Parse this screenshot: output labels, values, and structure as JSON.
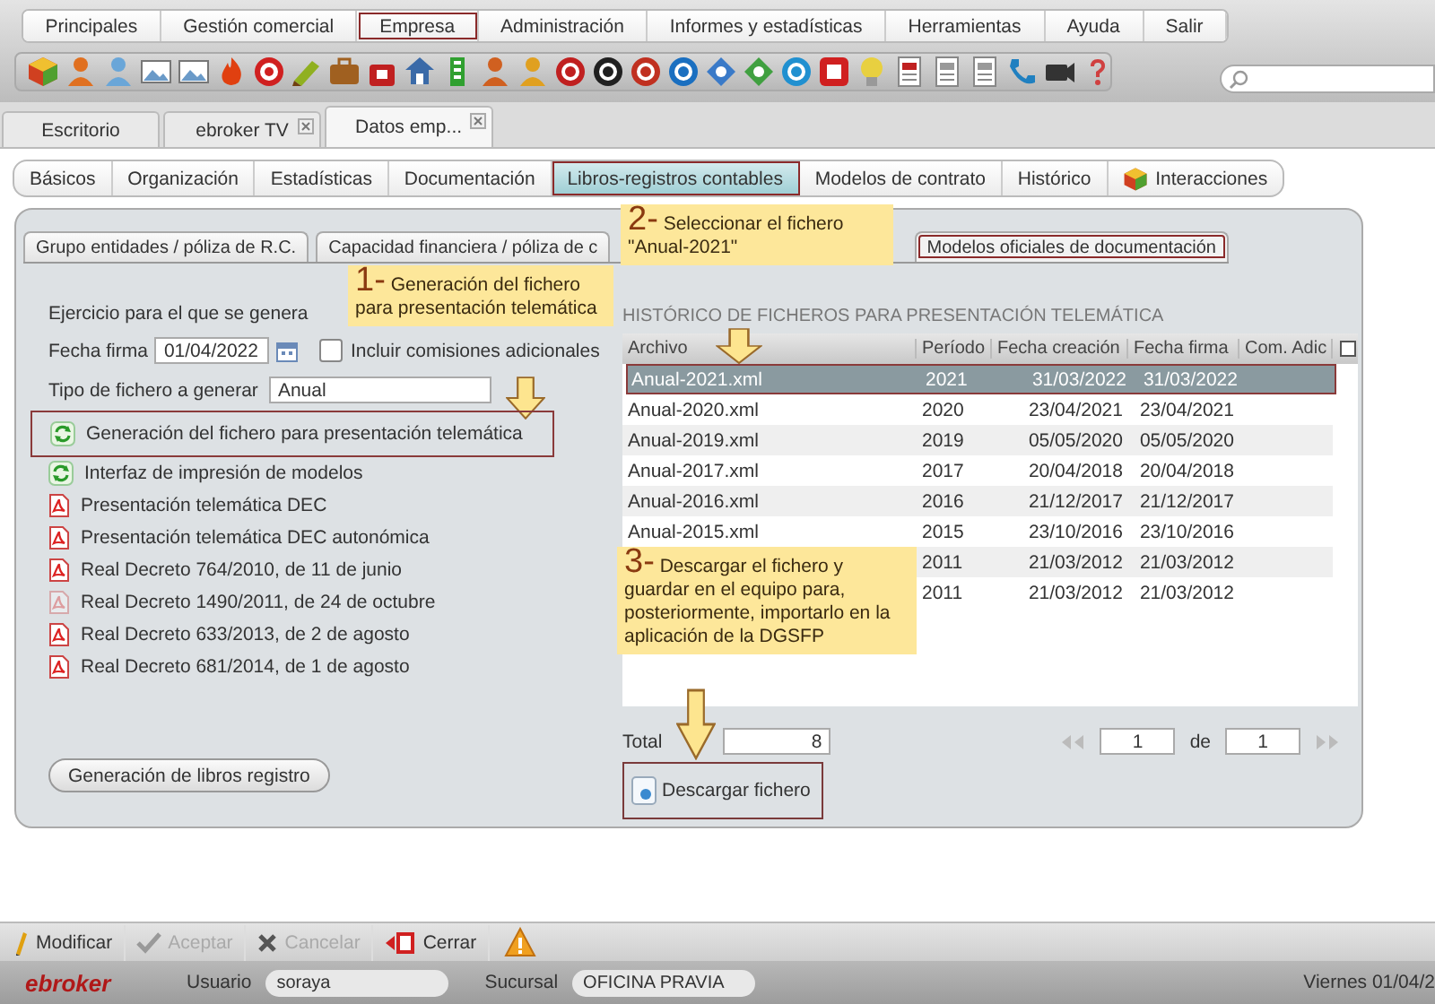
{
  "menu": [
    {
      "label": "Principales",
      "selected": false
    },
    {
      "label": "Gestión comercial",
      "selected": false
    },
    {
      "label": "Empresa",
      "selected": true
    },
    {
      "label": "Administración",
      "selected": false
    },
    {
      "label": "Informes y estadísticas",
      "selected": false
    },
    {
      "label": "Herramientas",
      "selected": false
    },
    {
      "label": "Ayuda",
      "selected": false
    },
    {
      "label": "Salir",
      "selected": false
    }
  ],
  "window_tabs": [
    {
      "label": "Escritorio",
      "selected": false,
      "closable": false
    },
    {
      "label": "ebroker TV",
      "selected": false,
      "closable": true
    },
    {
      "label": "Datos emp...",
      "selected": true,
      "closable": true
    }
  ],
  "section_tabs": [
    {
      "label": "Básicos",
      "selected": false,
      "kind": "text"
    },
    {
      "label": "Organización",
      "selected": false,
      "kind": "text"
    },
    {
      "label": "Estadísticas",
      "selected": false,
      "kind": "text"
    },
    {
      "label": "Documentación",
      "selected": false,
      "kind": "text"
    },
    {
      "label": "Libros-registros contables",
      "selected": true,
      "kind": "text"
    },
    {
      "label": "Modelos de contrato",
      "selected": false,
      "kind": "text"
    },
    {
      "label": "Histórico",
      "selected": false,
      "kind": "text"
    },
    {
      "label": "Interacciones",
      "selected": false,
      "kind": "icon"
    }
  ],
  "inner_tabs": [
    {
      "label": "Grupo entidades / póliza de R.C.",
      "selected": false
    },
    {
      "label": "Capacidad financiera / póliza de c",
      "selected": false
    },
    {
      "label": "Modelos oficiales de documentación",
      "selected": true
    }
  ],
  "form": {
    "ejercicio_label": "Ejercicio para el que se genera",
    "fecha_label": "Fecha firma",
    "fecha_value": "01/04/2022",
    "checkbox": {
      "label": "Incluir comisiones adicionales",
      "checked": false
    },
    "tipo_label": "Tipo de fichero a generar",
    "tipo_value": "Anual"
  },
  "actions": [
    {
      "kind": "generate",
      "label": "Generación del fichero para presentación telemática",
      "highlighted": true,
      "disabled": false
    },
    {
      "kind": "generate",
      "label": "Interfaz de impresión de modelos",
      "highlighted": false,
      "disabled": false
    },
    {
      "kind": "pdf",
      "label": "Presentación telemática DEC",
      "highlighted": false,
      "disabled": false
    },
    {
      "kind": "pdf",
      "label": "Presentación telemática DEC autonómica",
      "highlighted": false,
      "disabled": false
    },
    {
      "kind": "pdf",
      "label": "Real Decreto 764/2010, de 11 de junio",
      "highlighted": false,
      "disabled": false
    },
    {
      "kind": "pdf",
      "label": "Real Decreto 1490/2011, de 24 de octubre",
      "highlighted": false,
      "disabled": true
    },
    {
      "kind": "pdf",
      "label": "Real Decreto 633/2013, de 2 de agosto",
      "highlighted": false,
      "disabled": false
    },
    {
      "kind": "pdf",
      "label": "Real Decreto 681/2014, de 1 de agosto",
      "highlighted": false,
      "disabled": false
    }
  ],
  "books_button": "Generación de libros registro",
  "history": {
    "title": "HISTÓRICO DE FICHEROS PARA PRESENTACIÓN TELEMÁTICA",
    "columns": [
      "Archivo",
      "Período",
      "Fecha creación",
      "Fecha firma",
      "Com. Adic"
    ],
    "rows": [
      {
        "archivo": "Anual-2021.xml",
        "periodo": "2021",
        "creacion": "31/03/2022",
        "firma": "31/03/2022",
        "selected": true
      },
      {
        "archivo": "Anual-2020.xml",
        "periodo": "2020",
        "creacion": "23/04/2021",
        "firma": "23/04/2021",
        "selected": false
      },
      {
        "archivo": "Anual-2019.xml",
        "periodo": "2019",
        "creacion": "05/05/2020",
        "firma": "05/05/2020",
        "selected": false
      },
      {
        "archivo": "Anual-2017.xml",
        "periodo": "2017",
        "creacion": "20/04/2018",
        "firma": "20/04/2018",
        "selected": false
      },
      {
        "archivo": "Anual-2016.xml",
        "periodo": "2016",
        "creacion": "21/12/2017",
        "firma": "21/12/2017",
        "selected": false
      },
      {
        "archivo": "Anual-2015.xml",
        "periodo": "2015",
        "creacion": "23/10/2016",
        "firma": "23/10/2016",
        "selected": false
      },
      {
        "periodo": "2011",
        "creacion": "21/03/2012",
        "firma": "21/03/2012",
        "selected": false
      },
      {
        "periodo": "2011",
        "creacion": "21/03/2012",
        "firma": "21/03/2012",
        "selected": false
      }
    ],
    "total_label": "Total",
    "total_value": "8",
    "page_value": "1",
    "page_of": "de",
    "page_count": "1",
    "download": {
      "label": "Descargar fichero",
      "highlighted": true
    }
  },
  "callouts": [
    {
      "number": "1-",
      "text": "Generación del fichero para presentación telemática"
    },
    {
      "number": "2-",
      "text": "Seleccionar el fichero \"Anual-2021\""
    },
    {
      "number": "3-",
      "text": "Descargar el fichero y guardar en el equipo para, posteriormente, importarlo en la aplicación de la DGSFP"
    }
  ],
  "bottom_toolbar": [
    {
      "kind": "edit",
      "label": "Modificar",
      "disabled": false
    },
    {
      "kind": "accept",
      "label": "Aceptar",
      "disabled": true
    },
    {
      "kind": "cancel",
      "label": "Cancelar",
      "disabled": true
    },
    {
      "kind": "close",
      "label": "Cerrar",
      "disabled": false
    }
  ],
  "status_bar": {
    "logo": "ebroker",
    "user_label": "Usuario",
    "user": "soraya",
    "branch_label": "Sucursal",
    "branch": "OFICINA PRAVIA",
    "date": "Viernes 01/04/2"
  }
}
